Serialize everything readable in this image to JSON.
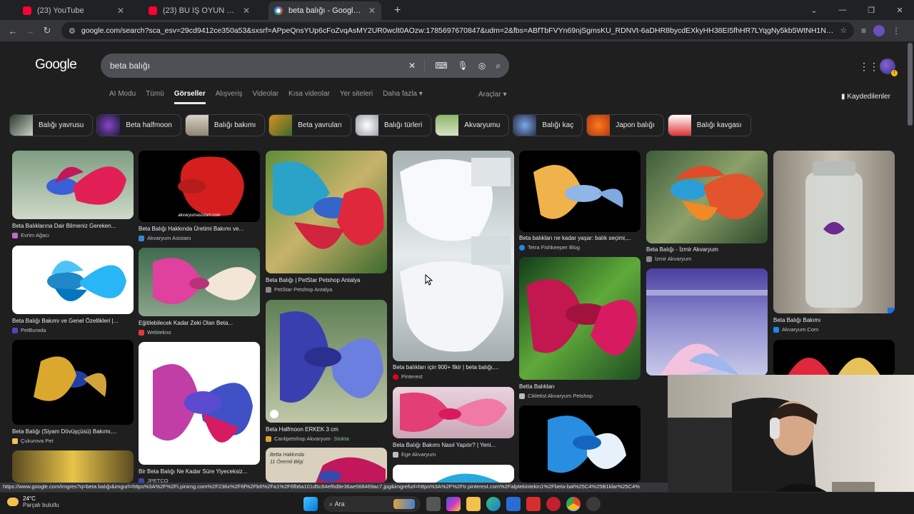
{
  "browser": {
    "tabs": [
      {
        "title": "(23) YouTube",
        "icon": "youtube-icon"
      },
      {
        "title": "(23) BU İŞ OYUN OYNAMAYA B",
        "icon": "youtube-icon"
      },
      {
        "title": "beta balığı - Google'da Ara",
        "icon": "google-icon"
      }
    ],
    "url": "google.com/search?sca_esv=29cd9412ce350a53&sxsrf=APpeQnsYUp6cFoZvqAsMY2UR0wclt0AOzw:1785697670847&udm=2&fbs=ABfTbFVYn69njSgmsKU_RDNVt-6aDHR8bycdEXkyHH38EI5fhHR7LYqgNy5kb5WtNH1Nq9nfs197E1NJ0R3RQHGJztLmAwuWj9...",
    "status_url": "https://www.google.com/imgres?q=beta balığı&imgurl=https%3A%2F%2Fi.pinimg.com%2F236x%2F6f%2Fb6%2Fa1%2F6fb6a101d5c84ef6d8e36ae568469ac7.jpg&imgrefurl=https%3A%2F%2Ftr.pinterest.com%2Falptekintekin1%2Fbeta-bal%25C4%25B1klar%25C4%"
  },
  "google": {
    "logo": "Google",
    "query": "beta balığı",
    "tabs": [
      "AI Modu",
      "Tümü",
      "Görseller",
      "Alışveriş",
      "Videolar",
      "Kısa videolar",
      "Yer siteleri",
      "Daha fazla"
    ],
    "tools": "Araçlar",
    "saved": "Kaydedilenler",
    "chips": [
      "Balığı yavrusu",
      "Beta halfmoon",
      "Balığı bakımı",
      "Beta yavruları",
      "Balığı türleri",
      "Akvaryumu",
      "Balığı kaç",
      "Japon balığı",
      "Balığı kavgası"
    ]
  },
  "results": [
    {
      "caption": "Beta Balıklarına Dair Bilmeniz Gereken...",
      "source": "Evrim Ağacı"
    },
    {
      "caption": "Beta Balığı Bakımı ve Genel Özellikleri |...",
      "source": "PetBurada"
    },
    {
      "caption": "Beta Balığı (Siyam Dövüşçüsü) Bakımı,...",
      "source": "Çukurova Pet"
    },
    {
      "caption": "Beta Balığı Hakkında Üretimi Bakımı ve...",
      "source": "Akvaryum Asistanı"
    },
    {
      "caption": "Eğitilebilecek Kadar Zeki Olan Beta...",
      "source": "Webtekno"
    },
    {
      "caption": "Bir Beta Balığı Ne Kadar Süre Yiyeceksiz...",
      "source": "JPETCO"
    },
    {
      "caption": "Beta Balığı | PetStar Petshop Antalya",
      "source": "PetStar Petshop Antalya"
    },
    {
      "caption": "Beta Halfmoon ERKEK 3 cm",
      "source": "Canlipetshop Akvaryum",
      "extra": " · Stokta"
    },
    {
      "caption": "Beta balıkları için 900+ fikir | beta balığı,...",
      "source": "Pinterest"
    },
    {
      "caption": "Beta Balığı Bakımı Nasıl Yapılır? | Yeni...",
      "source": "Ege Akvaryum"
    },
    {
      "caption": "Beta balıkları ne kadar yaşar: balık seçimi,...",
      "source": "Tetra Fishkeeper Blog"
    },
    {
      "caption": "Betta Balıkları",
      "source": "Cikletist Akvaryum Petshop"
    },
    {
      "caption": "Beta Balığı - İzmir Akvaryum",
      "source": "İzmir Akvaryum"
    },
    {
      "caption": "Beta Balığı Bakımı",
      "source": "Akvaryum.Com"
    }
  ],
  "image_text": {
    "watermark_1": "akvaryumasistani.com",
    "book_1": "Betta Hakkında",
    "book_2": "11 Önemli Bilgi"
  },
  "taskbar": {
    "temp": "24°C",
    "weather": "Parçalı bulutlu",
    "search": "Ara"
  }
}
